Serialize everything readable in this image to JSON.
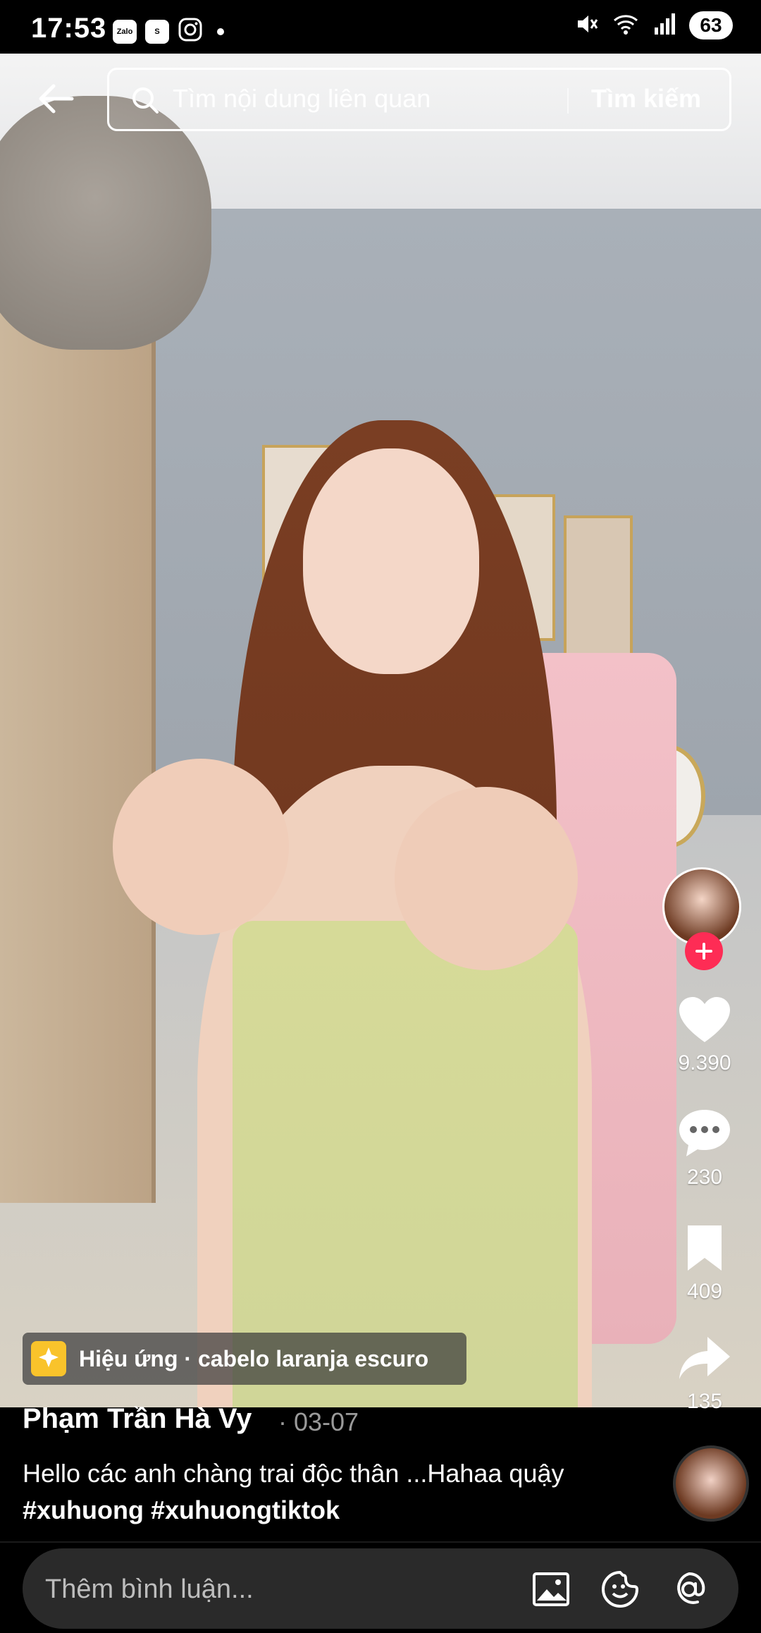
{
  "status_bar": {
    "time": "17:53",
    "app_icons": [
      "Zalo",
      "S"
    ],
    "battery": "63"
  },
  "search": {
    "placeholder": "Tìm nội dung liên quan",
    "button_label": "Tìm kiếm"
  },
  "actions": {
    "likes": "9.390",
    "comments": "230",
    "saves": "409",
    "shares": "135"
  },
  "effect": {
    "label": "Hiệu ứng · cabelo laranja escuro"
  },
  "post": {
    "author": "Phạm Trần Hà Vy",
    "date": "· 03-07",
    "caption_text": "Hello các anh chàng trai độc thân ...Hahaa quậy",
    "hashtags": [
      "#xuhuong",
      "#xuhuongtiktok"
    ]
  },
  "comment_bar": {
    "placeholder": "Thêm bình luận..."
  },
  "colors": {
    "accent": "#fe2c55",
    "effect_icon": "#f9c32b"
  }
}
